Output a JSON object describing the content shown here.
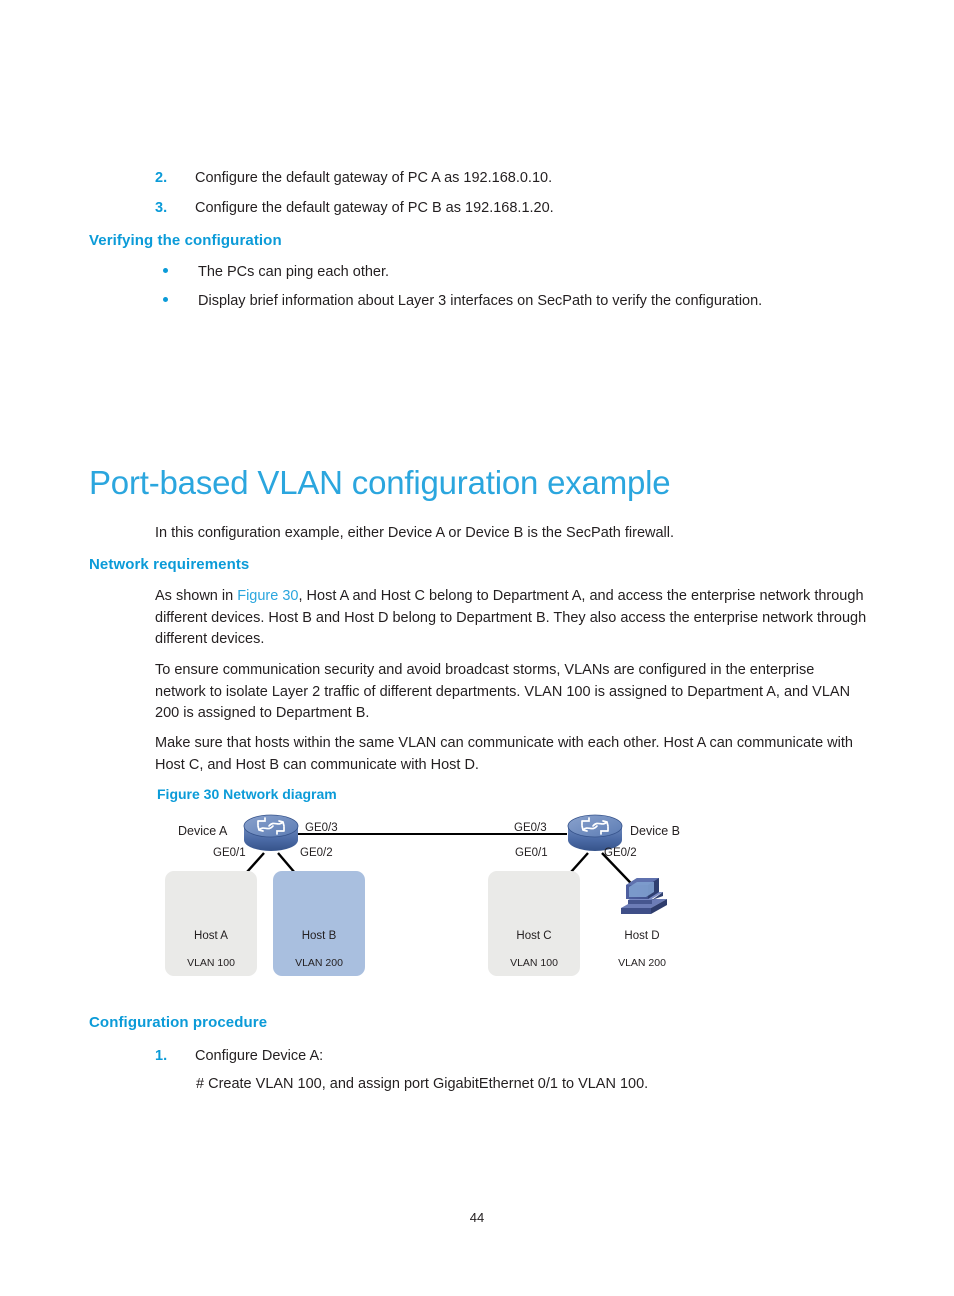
{
  "document": {
    "page_number": "44"
  },
  "top_list": {
    "items": [
      {
        "marker": "2.",
        "text": "Configure the default gateway of PC A as 192.168.0.10."
      },
      {
        "marker": "3.",
        "text": "Configure the default gateway of PC B as 192.168.1.20."
      }
    ]
  },
  "verifying": {
    "heading": "Verifying the configuration",
    "bullets": [
      "The PCs can ping each other.",
      "Display brief information about Layer 3 interfaces on SecPath to verify the configuration."
    ]
  },
  "main_section": {
    "title": "Port-based VLAN configuration example",
    "intro": "In this configuration example, either Device A or Device B is the SecPath firewall."
  },
  "network_requirements": {
    "heading": "Network requirements",
    "para1_prefix": "As shown in ",
    "para1_link": "Figure 30",
    "para1_rest": ", Host A and Host C belong to Department A, and access the enterprise network through different devices. Host B and Host D belong to Department B. They also access the enterprise network through different devices.",
    "para2": "To ensure communication security and avoid broadcast storms, VLANs are configured in the enterprise network to isolate Layer 2 traffic of different departments. VLAN 100 is assigned to Department A, and VLAN 200 is assigned to Department B.",
    "para3": "Make sure that hosts within the same VLAN can communicate with each other. Host A can communicate with Host C, and Host B can communicate with Host D."
  },
  "figure": {
    "caption": "Figure 30 Network diagram",
    "devices": [
      {
        "name": "Device A"
      },
      {
        "name": "Device B"
      }
    ],
    "port_labels": {
      "a_ge03": "GE0/3",
      "a_ge01": "GE0/1",
      "a_ge02": "GE0/2",
      "b_ge03": "GE0/3",
      "b_ge01": "GE0/1",
      "b_ge02": "GE0/2"
    },
    "hosts": [
      {
        "name": "Host A",
        "vlan": "VLAN 100",
        "box_color": "#eaeae8"
      },
      {
        "name": "Host B",
        "vlan": "VLAN 200",
        "box_color": "#a9bfdf"
      },
      {
        "name": "Host C",
        "vlan": "VLAN 100",
        "box_color": "#eaeae8"
      },
      {
        "name": "Host D",
        "vlan": "VLAN 200",
        "box_color": "transparent"
      }
    ]
  },
  "configuration_procedure": {
    "heading": "Configuration procedure",
    "step_marker": "1.",
    "step_text": "Configure Device A:",
    "command_comment": "# Create VLAN 100, and assign port GigabitEthernet 0/1 to VLAN 100."
  },
  "colors": {
    "heading_blue": "#0b9bd8",
    "title_blue": "#2ba6de",
    "body_black": "#231f20",
    "vlan_gray": "#eaeae8",
    "vlan_blue": "#a9bfdf",
    "router_blue": "#4a6aa5"
  }
}
